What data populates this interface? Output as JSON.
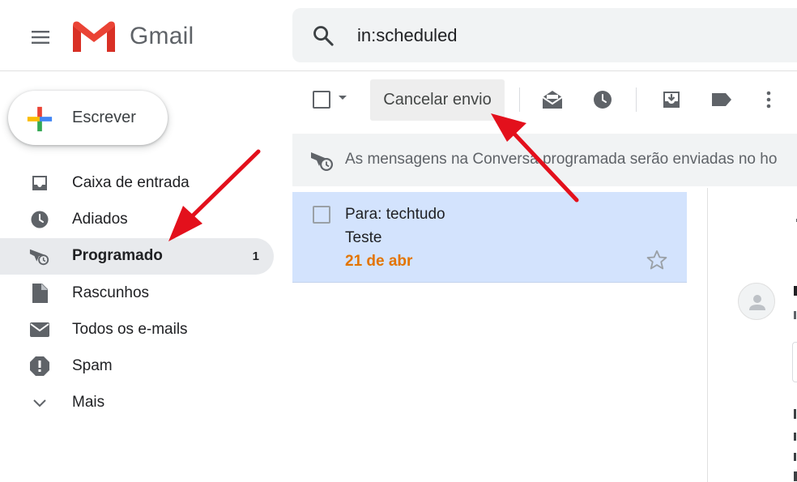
{
  "header": {
    "app_name": "Gmail",
    "search_value": "in:scheduled",
    "icons": [
      "menu-icon",
      "gmail-logo",
      "search-icon"
    ]
  },
  "sidebar": {
    "compose_label": "Escrever",
    "items": [
      {
        "label": "Caixa de entrada",
        "icon": "inbox-icon"
      },
      {
        "label": "Adiados",
        "icon": "clock-icon"
      },
      {
        "label": "Programado",
        "icon": "schedule-send-icon",
        "count": "1",
        "active": true
      },
      {
        "label": "Rascunhos",
        "icon": "draft-icon"
      },
      {
        "label": "Todos os e-mails",
        "icon": "mail-icon"
      },
      {
        "label": "Spam",
        "icon": "spam-icon"
      },
      {
        "label": "Mais",
        "icon": "chevron-down-icon"
      }
    ]
  },
  "toolbar": {
    "cancel_send_label": "Cancelar envio",
    "icons": [
      "select-checkbox",
      "select-dropdown-caret",
      "mark-read-icon",
      "snooze-icon",
      "move-to-inbox-icon",
      "label-icon",
      "more-vert-icon"
    ]
  },
  "banner": {
    "text": "As mensagens na Conversa programada serão enviadas no ho",
    "icon": "schedule-send-icon"
  },
  "messages": [
    {
      "to": "Para: techtudo",
      "subject": "Teste",
      "date": "21 de abr",
      "starred": false
    }
  ],
  "colors": {
    "selected_row": "#d3e3fd",
    "date_accent": "#e37400",
    "annotation_arrow": "#e3101c",
    "active_nav": "#e8eaed"
  }
}
